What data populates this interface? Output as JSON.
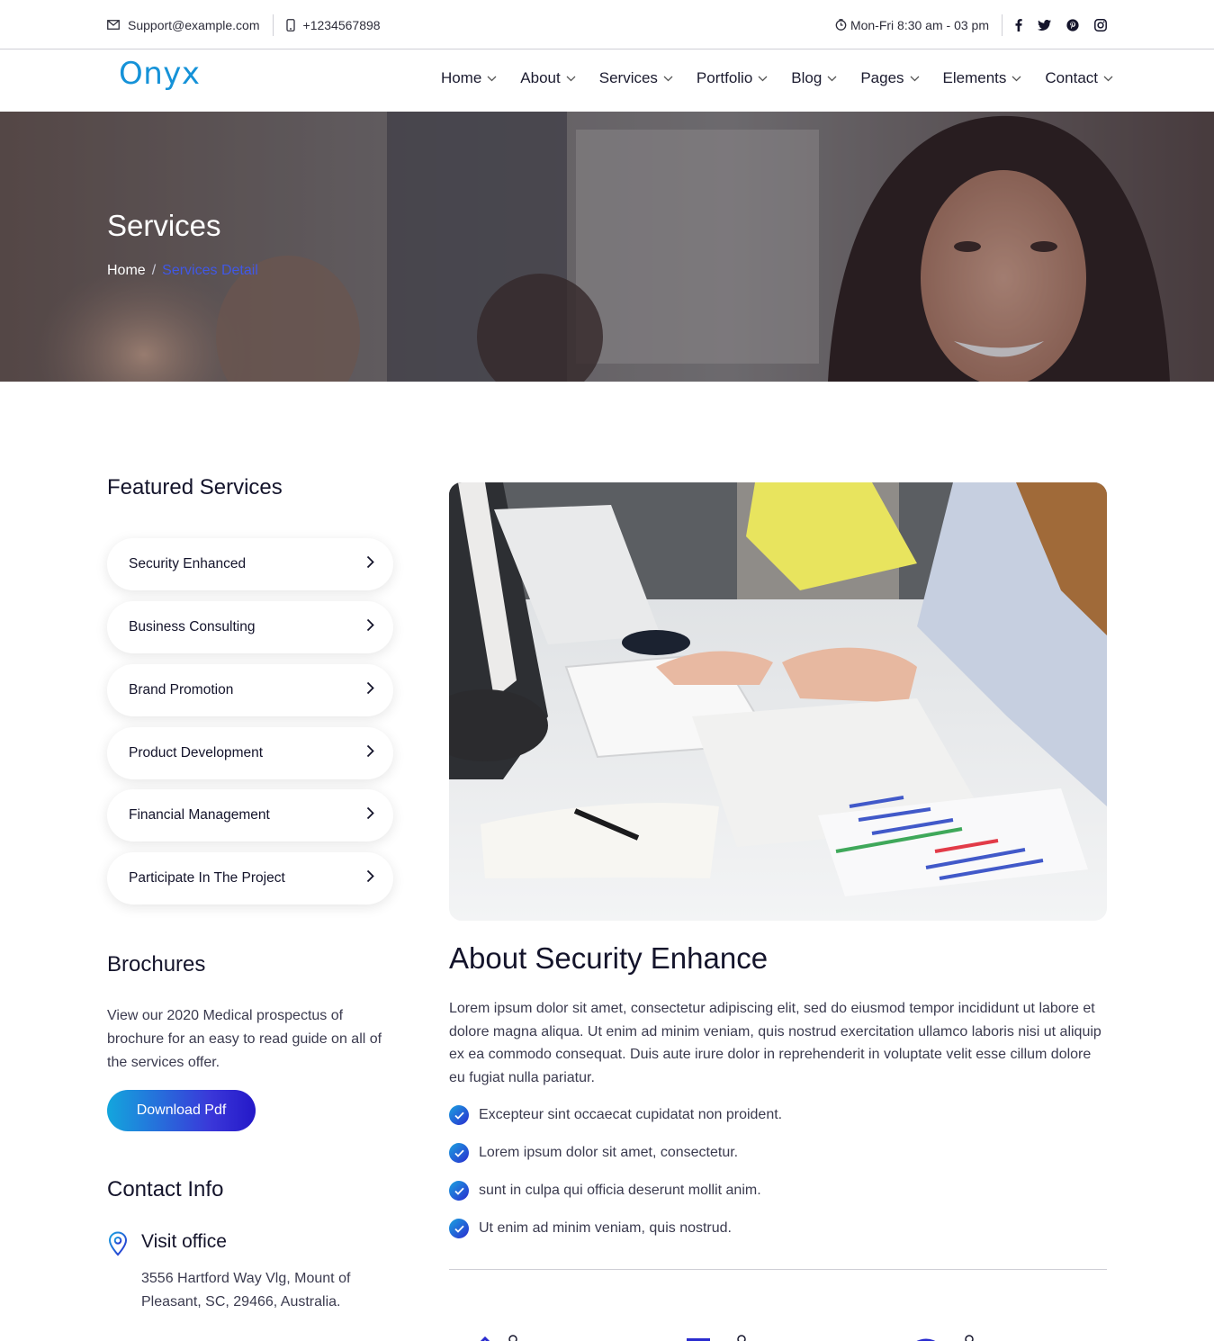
{
  "topbar": {
    "email": "Support@example.com",
    "phone": "+1234567898",
    "hours": "Mon-Fri 8:30 am - 03 pm",
    "icons": [
      "mail-icon",
      "phone-icon",
      "clock-icon"
    ],
    "social": [
      "facebook-icon",
      "twitter-icon",
      "pinterest-icon",
      "instagram-icon"
    ]
  },
  "header": {
    "logo": "Onyx",
    "nav": [
      "Home",
      "About",
      "Services",
      "Portfolio",
      "Blog",
      "Pages",
      "Elements",
      "Contact"
    ]
  },
  "hero": {
    "title": "Services",
    "breadcrumb": [
      "Home",
      "Services Detail"
    ]
  },
  "sidebar": {
    "featured_title": "Featured Services",
    "services": [
      "Security Enhanced",
      "Business Consulting",
      "Brand Promotion",
      "Product Development",
      "Financial Management",
      "Participate In The Project"
    ],
    "brochures_title": "Brochures",
    "brochures_text": "View our 2020 Medical prospectus of brochure for an easy to read guide on all of the services offer.",
    "download_label": "Download Pdf",
    "contact_title": "Contact Info",
    "visit_title": "Visit office",
    "address": "3556 Hartford Way Vlg, Mount of Pleasant, SC, 29466, Australia."
  },
  "main": {
    "title": "About Security Enhance",
    "body": "Lorem ipsum dolor sit amet, consectetur adipiscing elit, sed do eiusmod tempor incididunt ut labore et dolore magna aliqua. Ut enim ad minim veniam, quis nostrud exercitation ullamco laboris nisi ut aliquip ex ea commodo consequat. Duis aute irure dolor in reprehenderit in voluptate velit esse cillum dolore eu fugiat nulla pariatur.",
    "checklist": [
      "Excepteur sint occaecat cupidatat non proident.",
      "Lorem ipsum dolor sit amet, consectetur.",
      "sunt in culpa qui officia deserunt mollit anim.",
      "Ut enim ad minim veniam, quis nostrud."
    ]
  },
  "colors": {
    "accent": "#1592d8",
    "breadcrumb_active": "#4058e6",
    "button_gradient_start": "#13a6dd",
    "button_gradient_end": "#2418c8",
    "heading": "#14142b"
  }
}
